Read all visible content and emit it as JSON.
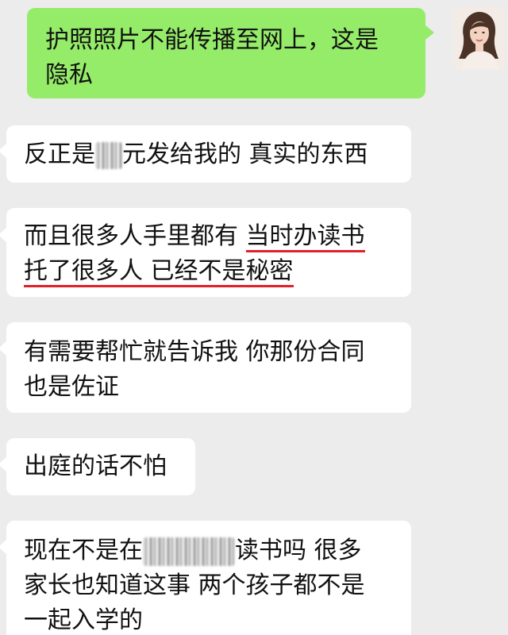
{
  "colors": {
    "background": "#ececec",
    "incoming_bubble": "#ffffff",
    "outgoing_bubble": "#95ec69",
    "underline": "#e0202a"
  },
  "contact": {
    "avatar_icon": "woman-portrait-avatar"
  },
  "messages": [
    {
      "direction": "outgoing",
      "lines": [
        "护照照片不能传播至网上，这是",
        "隐私"
      ]
    },
    {
      "direction": "incoming",
      "line_parts": [
        [
          "反正是",
          "元发给我的 真实的东西"
        ]
      ]
    },
    {
      "direction": "incoming",
      "line1_plain": "而且很多人手里都有 ",
      "line1_underlined": "当时办读书",
      "line2_underlined": "托了很多人 已经不是秘密"
    },
    {
      "direction": "incoming",
      "lines": [
        "有需要帮忙就告诉我 你那份合同",
        "也是佐证"
      ]
    },
    {
      "direction": "incoming",
      "lines": [
        "出庭的话不怕"
      ]
    },
    {
      "direction": "incoming",
      "line1_before": "现在不是在",
      "line1_after": "读书吗 很多",
      "lines_rest": [
        "家长也知道这事 两个孩子都不是",
        "一起入学的"
      ]
    }
  ]
}
